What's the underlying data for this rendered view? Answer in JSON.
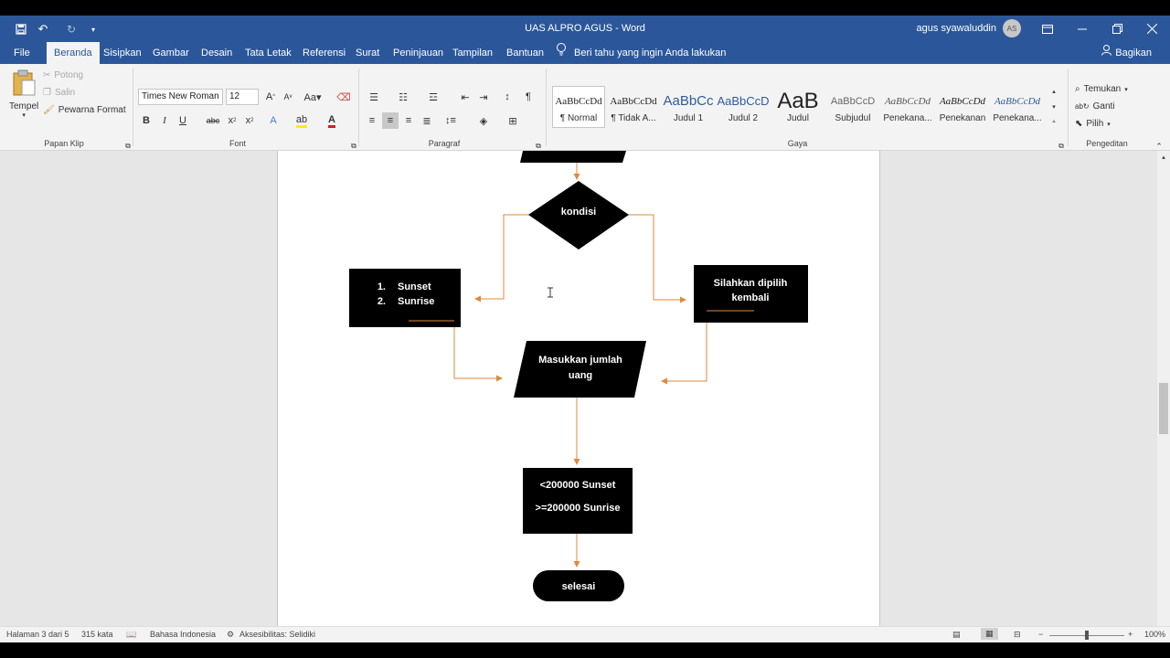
{
  "window": {
    "title": "UAS ALPRO AGUS  -  Word",
    "user_name": "agus syawaluddin",
    "user_initials": "AS"
  },
  "tabs": [
    "File",
    "Beranda",
    "Sisipkan",
    "Gambar",
    "Desain",
    "Tata Letak",
    "Referensi",
    "Surat",
    "Peninjauan",
    "Tampilan",
    "Bantuan"
  ],
  "tell_me": "Beri tahu yang ingin Anda lakukan",
  "share": "Bagikan",
  "ribbon": {
    "clipboard": {
      "paste": "Tempel",
      "cut": "Potong",
      "copy": "Salin",
      "format_painter": "Pewarna Format",
      "label": "Papan Klip"
    },
    "font": {
      "family": "Times New Roman",
      "size": "12",
      "label": "Font"
    },
    "paragraph": {
      "label": "Paragraf"
    },
    "styles": {
      "label": "Gaya",
      "items": [
        {
          "preview": "AaBbCcDd",
          "name": "¶ Normal"
        },
        {
          "preview": "AaBbCcDd",
          "name": "¶ Tidak A..."
        },
        {
          "preview": "AaBbCc",
          "name": "Judul 1"
        },
        {
          "preview": "AaBbCcD",
          "name": "Judul 2"
        },
        {
          "preview": "AaB",
          "name": "Judul"
        },
        {
          "preview": "AaBbCcD",
          "name": "Subjudul"
        },
        {
          "preview": "AaBbCcDd",
          "name": "Penekana..."
        },
        {
          "preview": "AaBbCcDd",
          "name": "Penekanan"
        },
        {
          "preview": "AaBbCcDd",
          "name": "Penekana..."
        }
      ]
    },
    "editing": {
      "find": "Temukan",
      "replace": "Ganti",
      "select": "Pilih",
      "label": "Pengeditan"
    }
  },
  "flowchart": {
    "decision": "kondisi",
    "left_list": [
      "Sunset",
      "Sunrise"
    ],
    "left_list_numbers": [
      "1.",
      "2."
    ],
    "right_box": [
      "Silahkan dipilih",
      "kembali"
    ],
    "input": [
      "Masukkan jumlah",
      "uang"
    ],
    "process": [
      "<200000 Sunset",
      ">=200000 Sunrise"
    ],
    "terminal": "selesai"
  },
  "status": {
    "page": "Halaman 3 dari 5",
    "words": "315 kata",
    "language": "Bahasa Indonesia",
    "accessibility": "Aksesibilitas: Selidiki",
    "zoom": "100%"
  },
  "colors": {
    "word_blue": "#2b579a",
    "arrow_orange": "#e0893a",
    "shape_fill": "#000000"
  }
}
